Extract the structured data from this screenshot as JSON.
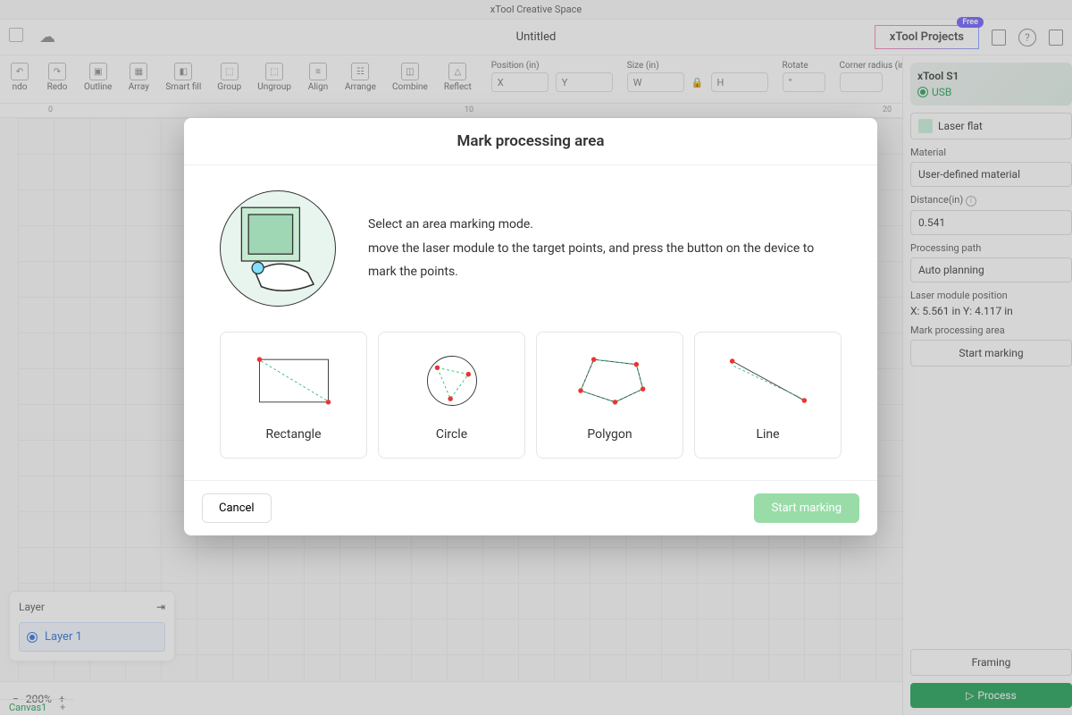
{
  "app_title": "xTool Creative Space",
  "document_name": "Untitled",
  "projects_button": "xTool Projects",
  "projects_tag": "Free",
  "toolbar": {
    "undo": "ndo",
    "redo": "Redo",
    "outline": "Outline",
    "array": "Array",
    "smartfill": "Smart fill",
    "group": "Group",
    "ungroup": "Ungroup",
    "align": "Align",
    "arrange": "Arrange",
    "combine": "Combine",
    "reflect": "Reflect"
  },
  "props": {
    "position_label": "Position (in)",
    "x": "X",
    "y": "Y",
    "size_label": "Size (in)",
    "w": "W",
    "h": "H",
    "rotate_label": "Rotate",
    "deg": "°",
    "corner_label": "Corner radius (in"
  },
  "ruler": {
    "a": "0",
    "b": "10",
    "c": "20"
  },
  "device": {
    "name": "xTool S1",
    "connection": "USB",
    "color": "#1a9e52"
  },
  "right": {
    "laser_mode": "Laser flat",
    "material_label": "Material",
    "material_value": "User-defined material",
    "distance_label": "Distance",
    "distance_unit": "(in)",
    "distance_value": "0.541",
    "path_label": "Processing path",
    "path_value": "Auto planning",
    "module_label": "Laser module position",
    "module_value": "X: 5.561 in  Y: 4.117 in",
    "mark_label": "Mark processing area",
    "mark_btn": "Start marking",
    "framing": "Framing",
    "process": "Process"
  },
  "layer": {
    "title": "Layer",
    "item": "Layer 1"
  },
  "footer": {
    "zoom": "200%",
    "canvas": "Canvas1"
  },
  "modal": {
    "title": "Mark processing area",
    "line1": "Select an area marking mode.",
    "line2": "move the laser module to the target points, and press the button on the device to mark the points.",
    "modes": {
      "rect": "Rectangle",
      "circle": "Circle",
      "polygon": "Polygon",
      "line": "Line"
    },
    "cancel": "Cancel",
    "start": "Start marking"
  }
}
